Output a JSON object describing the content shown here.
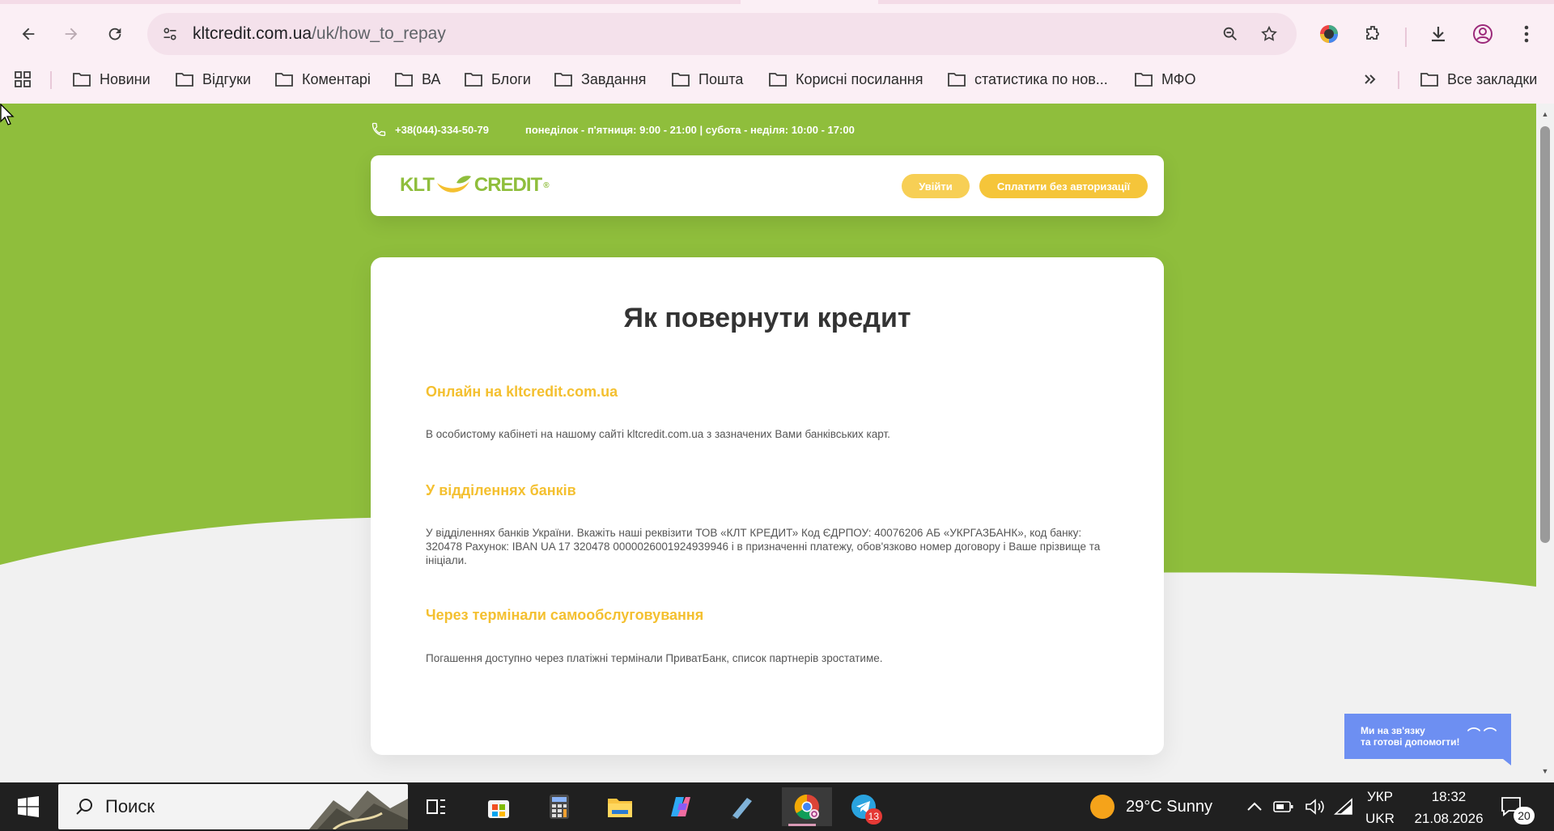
{
  "browser": {
    "url_domain": "kltcredit.com.ua",
    "url_path": "/uk/how_to_repay",
    "bookmarks": [
      "Новини",
      "Відгуки",
      "Коментарі",
      "ВА",
      "Блоги",
      "Завдання",
      "Пошта",
      "Корисні посилання",
      "статистика по нов...",
      "МФО"
    ],
    "all_bookmarks": "Все закладки"
  },
  "site": {
    "phone": "+38(044)-334-50-79",
    "hours": "понеділок - п'ятниця: 9:00 - 21:00 | субота - неділя: 10:00 - 17:00",
    "logo_left": "KLT",
    "logo_right": "CREDIT",
    "logo_reg": "®",
    "login_button": "Увійти",
    "pay_button": "Сплатити без авторизації",
    "brand_green": "#8fbe3c",
    "accent_yellow": "#f4c030"
  },
  "main": {
    "title": "Як повернути кредит",
    "sections": [
      {
        "heading": "Онлайн на kltcredit.com.ua",
        "text": "В особистому кабінеті на нашому сайті kltcredit.com.ua з зазначених Вами банківських карт."
      },
      {
        "heading": "У відділеннях банків",
        "text": "У відділеннях банків України. Вкажіть наші реквізити ТОВ «КЛТ КРЕДИТ» Код ЄДРПОУ: 40076206 АБ «УКРГАЗБАНК», код банку: 320478 Рахунок: IBAN UA 17 320478 0000026001924939946 і в призначенні платежу, обов'язково номер договору і Ваше прізвище та ініціали."
      },
      {
        "heading": "Через термінали самообслуговування",
        "text": "Погашення доступно через платіжні термінали ПриватБанк, список партнерів зростатиме."
      }
    ]
  },
  "chat": {
    "line1": "Ми на зв'язку",
    "line2": "та готові допомогти!"
  },
  "taskbar": {
    "search_placeholder": "Поиск",
    "weather": "29°C  Sunny",
    "lang_top": "УКР",
    "lang_bottom": "UKR",
    "time": "18:32",
    "date": "21.08.2026",
    "telegram_badge": "13",
    "notifications": "20"
  }
}
